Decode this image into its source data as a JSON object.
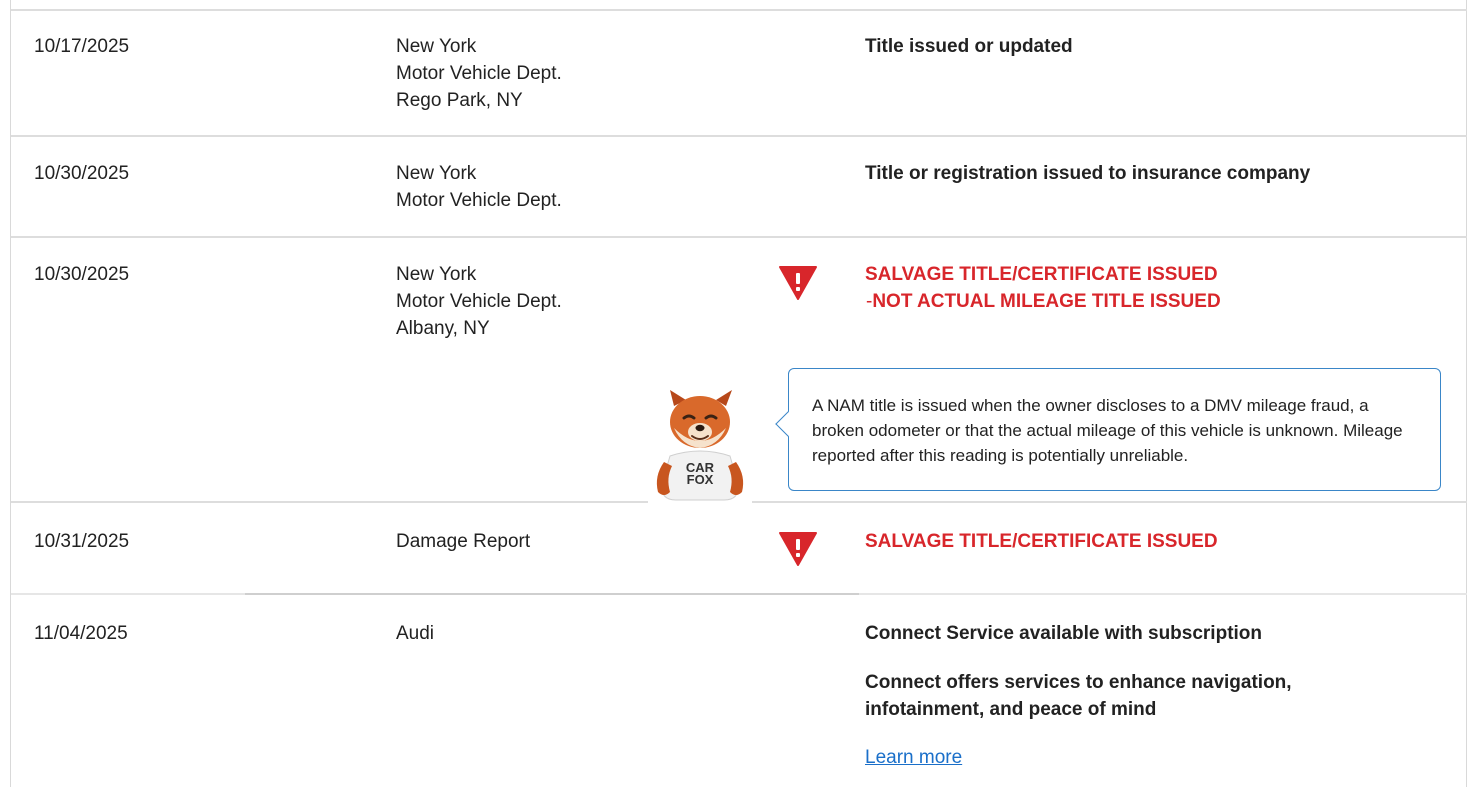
{
  "records": [
    {
      "date": "10/17/2025",
      "source": [
        "New York",
        "Motor Vehicle Dept.",
        "Rego Park, NY"
      ],
      "comments": [
        "Title issued or updated"
      ]
    },
    {
      "date": "10/30/2025",
      "source": [
        "New York",
        "Motor Vehicle Dept."
      ],
      "comments": [
        "Title or registration issued to insurance company"
      ]
    },
    {
      "date": "10/30/2025",
      "source": [
        "New York",
        "Motor Vehicle Dept.",
        "Albany, NY"
      ],
      "alert_line_1": "SALVAGE TITLE/CERTIFICATE ISSUED",
      "alert_dash": "-",
      "alert_line_2": "NOT ACTUAL MILEAGE TITLE ISSUED",
      "tooltip": "A NAM title is issued when the owner discloses to a DMV mileage fraud, a broken odometer or that the actual mileage of this vehicle is unknown. Mileage reported after this reading is potentially unreliable.",
      "mascot_shirt": [
        "CAR",
        "FOX"
      ]
    },
    {
      "date": "10/31/2025",
      "source": [
        "Damage Report"
      ],
      "alert_line_1": "SALVAGE TITLE/CERTIFICATE ISSUED"
    },
    {
      "date": "11/04/2025",
      "source": [
        "Audi"
      ],
      "comments": [
        "Connect Service available with subscription",
        "Connect offers services to enhance navigation,",
        "infotainment, and peace of mind"
      ],
      "link": "Learn more"
    }
  ],
  "colors": {
    "alert_red": "#d8262b",
    "link_blue": "#1a6fc9",
    "tooltip_border": "#3a86c8",
    "divider": "#dddddd"
  },
  "icons": {
    "alert": "shield-exclamation-icon",
    "mascot": "carfox-mascot"
  }
}
